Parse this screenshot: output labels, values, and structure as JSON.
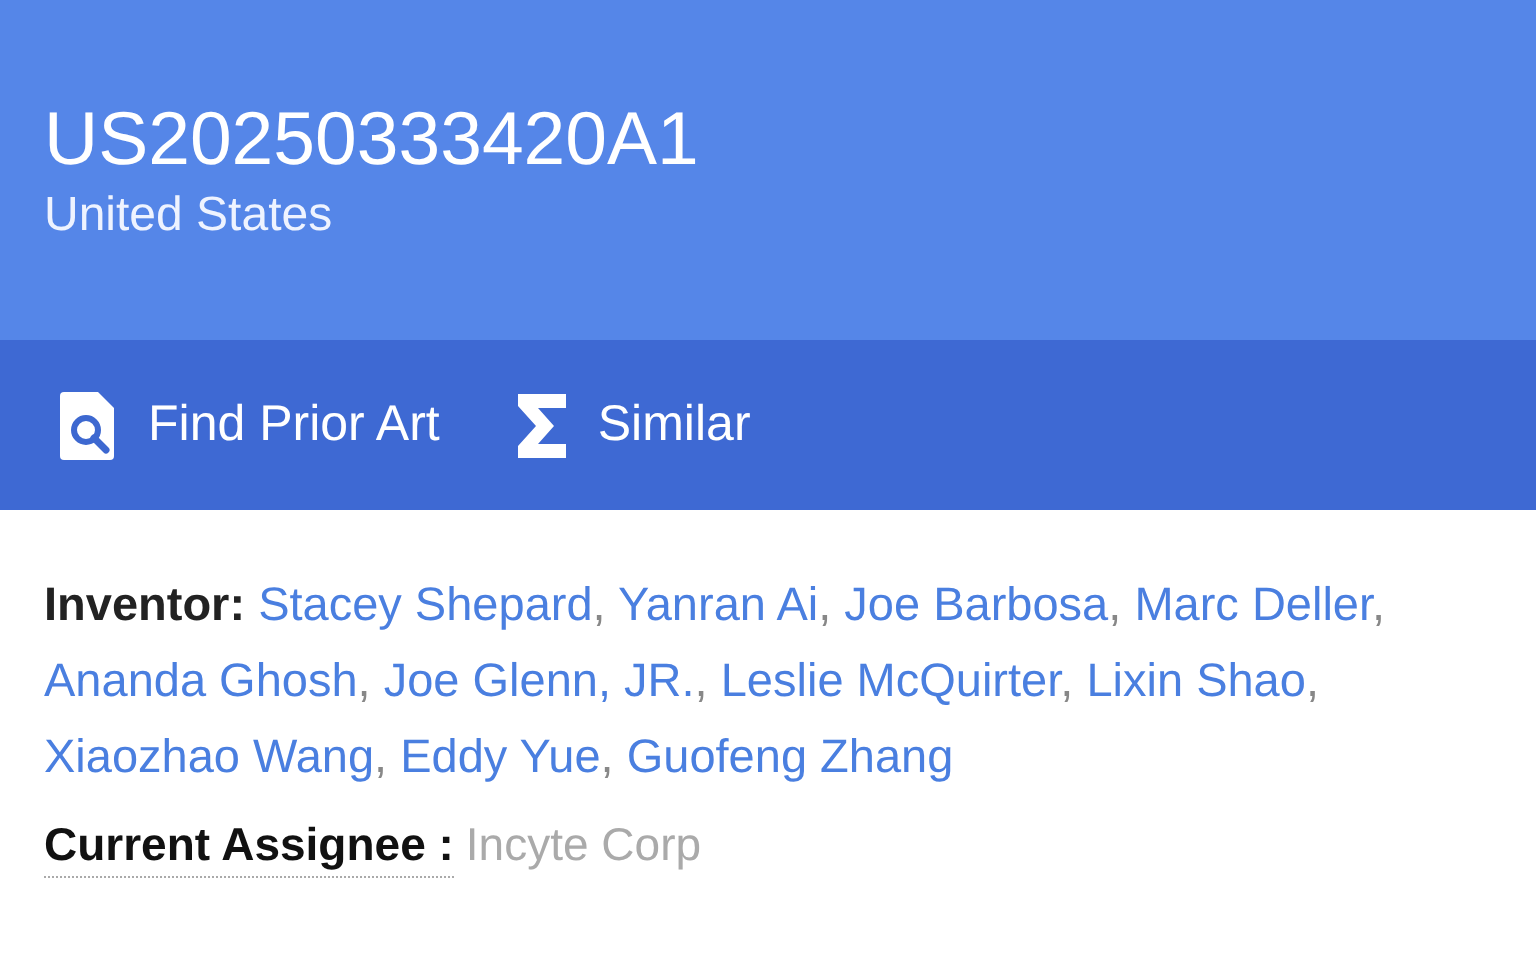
{
  "header": {
    "title": "US20250333420A1",
    "country": "United States"
  },
  "toolbar": [
    {
      "kind": "prior-art",
      "label": "Find Prior Art"
    },
    {
      "kind": "similar",
      "label": "Similar"
    }
  ],
  "inventor": {
    "label": "Inventor:",
    "separator": ",",
    "names": [
      "Stacey Shepard",
      "Yanran Ai",
      "Joe Barbosa",
      "Marc Deller",
      "Ananda Ghosh",
      "Joe Glenn, JR.",
      "Leslie McQuirter",
      "Lixin Shao",
      "Xiaozhao Wang",
      "Eddy Yue",
      "Guofeng Zhang"
    ]
  },
  "assignee": {
    "label": "Current Assignee :",
    "value": "Incyte Corp"
  }
}
